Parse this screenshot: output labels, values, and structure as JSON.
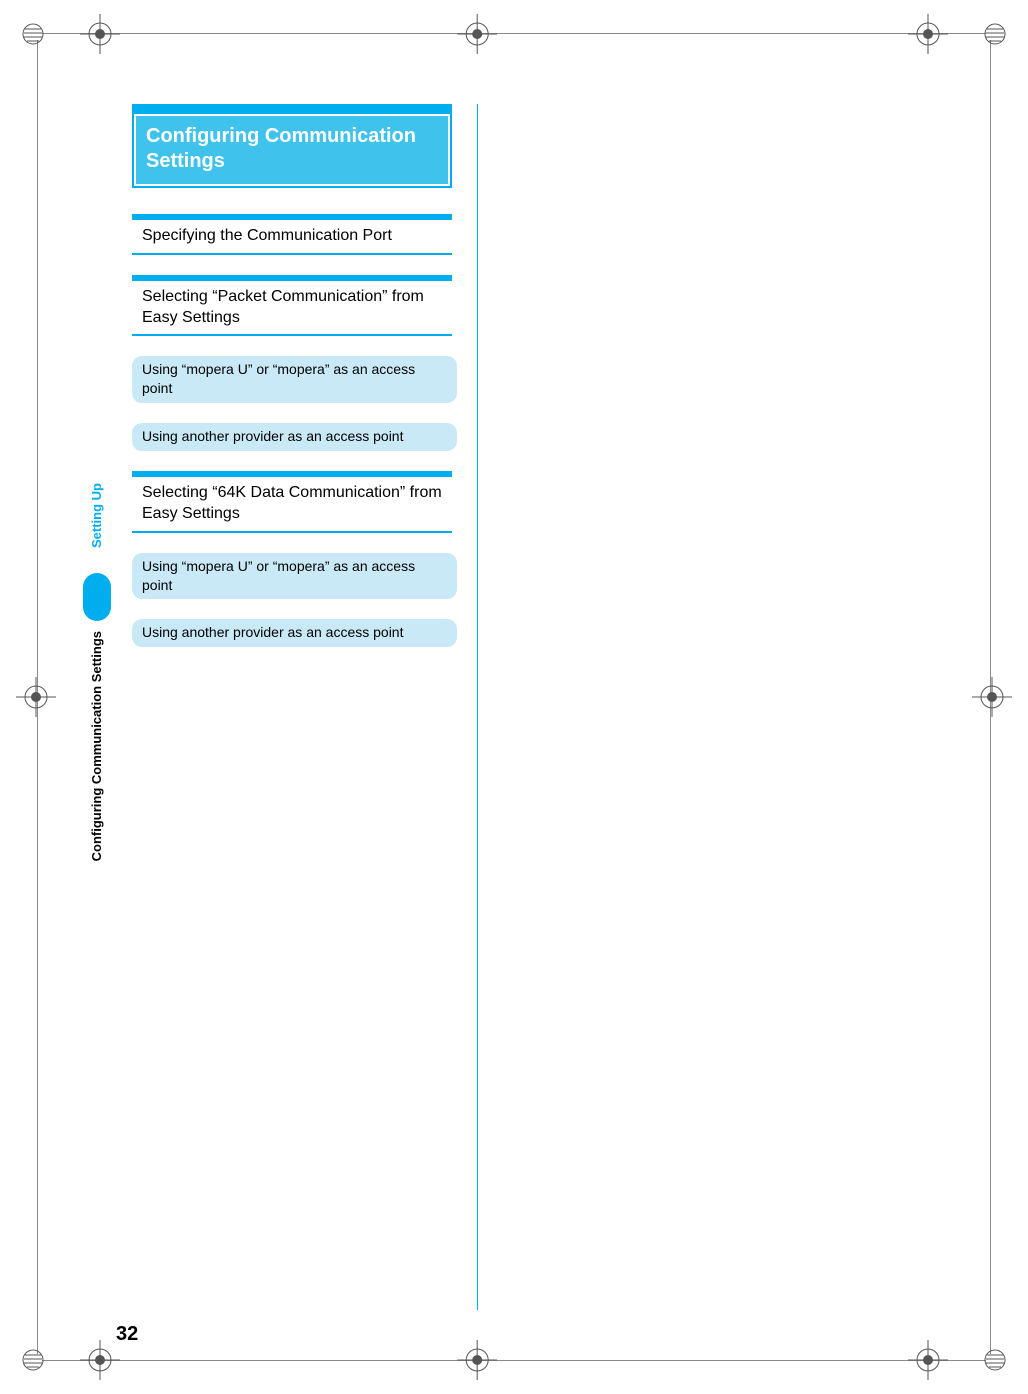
{
  "meta": {
    "domain": "document-scan",
    "page_number": "32"
  },
  "side": {
    "chapter_label": "Setting Up",
    "section_label": "Configuring Communication Settings"
  },
  "content": {
    "main_title": "Configuring Communication Settings",
    "sections": [
      {
        "heading": "Specifying the Communication Port",
        "items": []
      },
      {
        "heading": "Selecting “Packet Communication” from Easy Settings",
        "items": [
          "Using “mopera U” or “mopera” as an access point",
          "Using another provider as an access point"
        ]
      },
      {
        "heading": "Selecting “64K Data Communication” from Easy Settings",
        "items": [
          "Using “mopera U” or “mopera” as an access point",
          "Using another provider as an access point"
        ]
      }
    ]
  }
}
